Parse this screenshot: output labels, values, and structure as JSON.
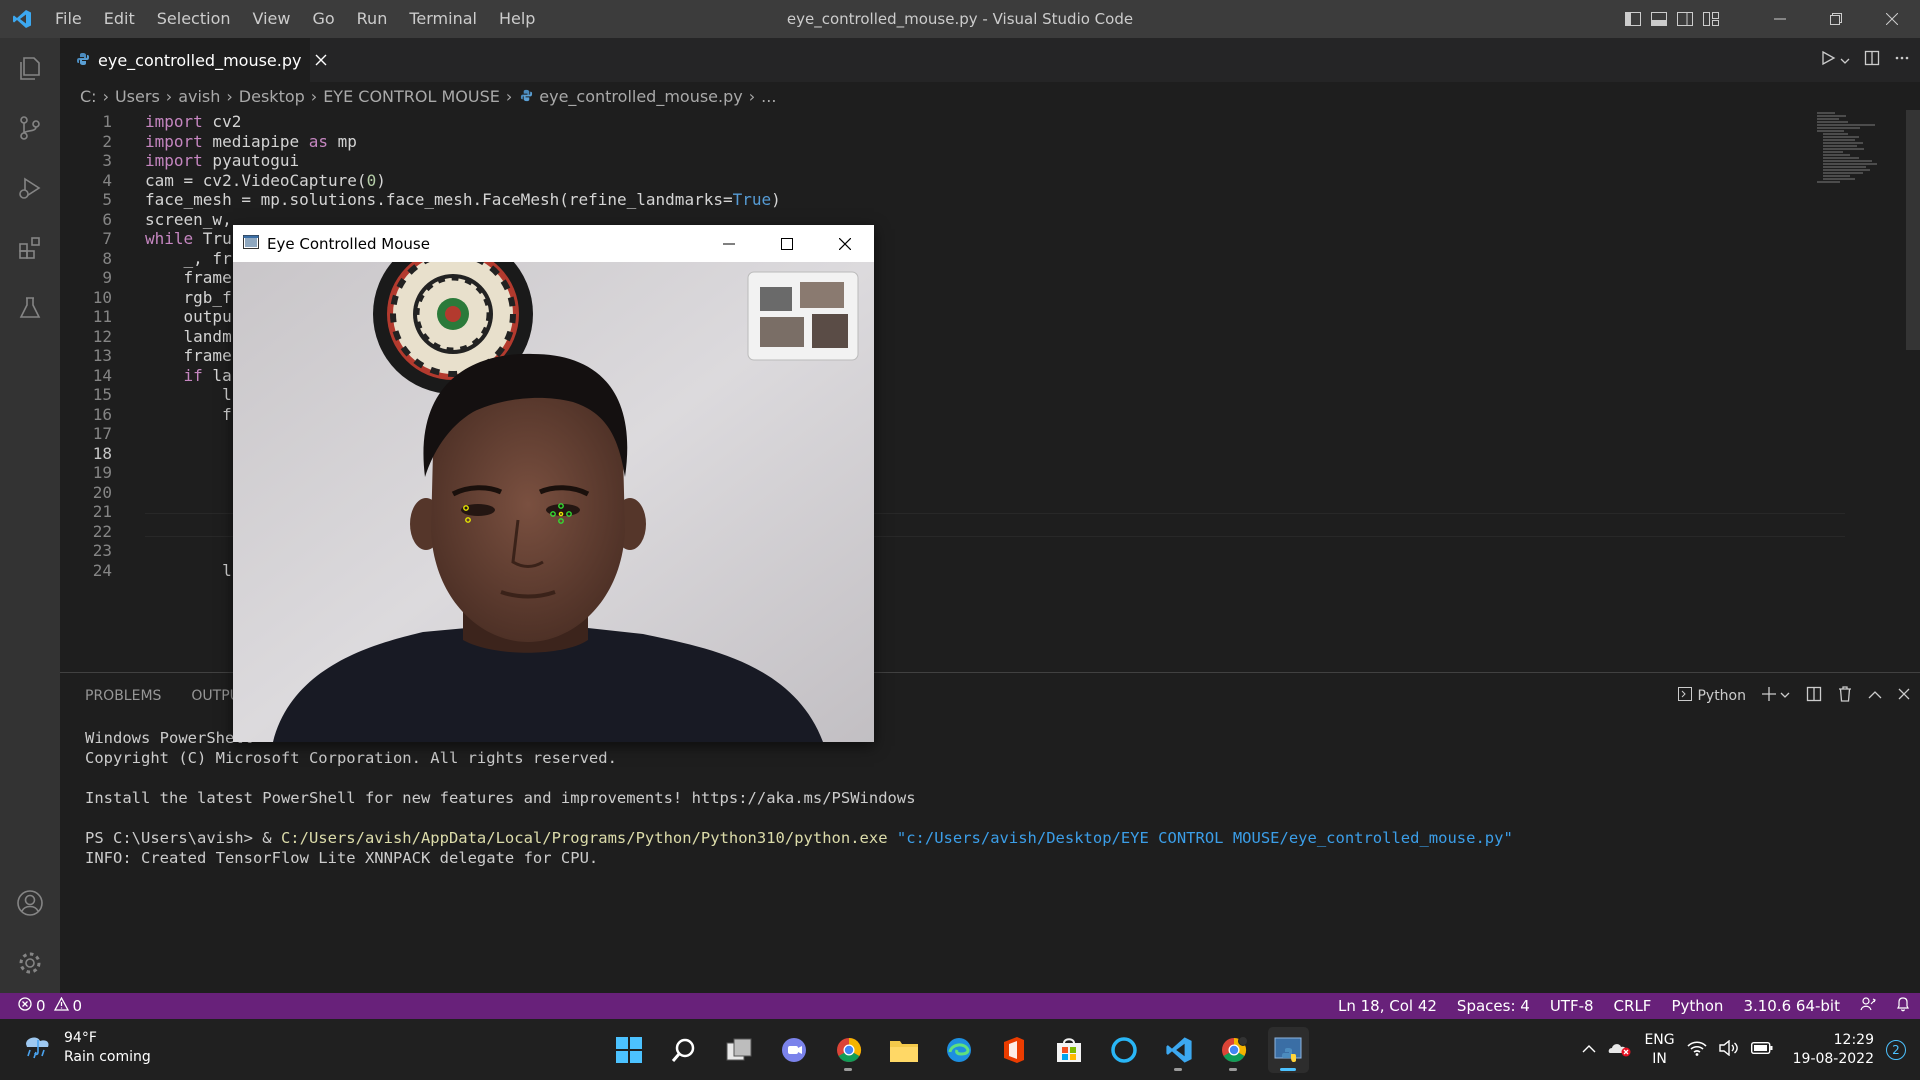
{
  "window": {
    "title": "eye_controlled_mouse.py - Visual Studio Code",
    "menu": [
      "File",
      "Edit",
      "Selection",
      "View",
      "Go",
      "Run",
      "Terminal",
      "Help"
    ]
  },
  "tab": {
    "label": "eye_controlled_mouse.py"
  },
  "breadcrumb": [
    "C:",
    "Users",
    "avish",
    "Desktop",
    "EYE CONTROL MOUSE",
    "eye_controlled_mouse.py",
    "..."
  ],
  "editor": {
    "active_line": 18,
    "lines": [
      {
        "n": "1",
        "code": "import cv2"
      },
      {
        "n": "2",
        "code": "import mediapipe as mp"
      },
      {
        "n": "3",
        "code": "import pyautogui"
      },
      {
        "n": "4",
        "code": "cam = cv2.VideoCapture(0)"
      },
      {
        "n": "5",
        "code": "face_mesh = mp.solutions.face_mesh.FaceMesh(refine_landmarks=True)"
      },
      {
        "n": "6",
        "code": "screen_w,"
      },
      {
        "n": "7",
        "code": "while Tru"
      },
      {
        "n": "8",
        "code": "    _, fr"
      },
      {
        "n": "9",
        "code": "    frame"
      },
      {
        "n": "10",
        "code": "    rgb_f"
      },
      {
        "n": "11",
        "code": "    outpu"
      },
      {
        "n": "12",
        "code": "    landm"
      },
      {
        "n": "13",
        "code": "    frame"
      },
      {
        "n": "14",
        "code": "    if la"
      },
      {
        "n": "15",
        "code": "        l"
      },
      {
        "n": "16",
        "code": "        f"
      },
      {
        "n": "17",
        "code": ""
      },
      {
        "n": "18",
        "code": ""
      },
      {
        "n": "19",
        "code": ""
      },
      {
        "n": "20",
        "code": ""
      },
      {
        "n": "21",
        "code": ""
      },
      {
        "n": "22",
        "code": ""
      },
      {
        "n": "23",
        "code": ""
      },
      {
        "n": "24",
        "code": "        l"
      }
    ]
  },
  "panel": {
    "tabs": [
      "PROBLEMS",
      "OUTPUT"
    ],
    "shell": "Python",
    "terminal": {
      "l1": "Windows PowerShell",
      "l2": "Copyright (C) Microsoft Corporation. All rights reserved.",
      "l3": "Install the latest PowerShell for new features and improvements! https://aka.ms/PSWindows",
      "prompt": "PS C:\\Users\\avish> & ",
      "exe": "C:/Users/avish/AppData/Local/Programs/Python/Python310/python.exe",
      "arg": "\"c:/Users/avish/Desktop/EYE CONTROL MOUSE/eye_controlled_mouse.py\"",
      "l5": "INFO: Created TensorFlow Lite XNNPACK delegate for CPU."
    }
  },
  "status": {
    "errors": "0",
    "warnings": "0",
    "position": "Ln 18, Col 42",
    "spaces": "Spaces: 4",
    "encoding": "UTF-8",
    "eol": "CRLF",
    "language": "Python",
    "interpreter": "3.10.6 64-bit"
  },
  "cv_window": {
    "title": "Eye Controlled Mouse"
  },
  "taskbar": {
    "temp": "94°F",
    "weather": "Rain coming",
    "lang1": "ENG",
    "lang2": "IN",
    "time": "12:29",
    "date": "19-08-2022",
    "notifications": "2"
  },
  "colors": {
    "statusbar": "#68217a",
    "titlebar": "#3c3c3c",
    "activity": "#333333",
    "keyword": "#c586c0",
    "constant": "#569cd6"
  }
}
